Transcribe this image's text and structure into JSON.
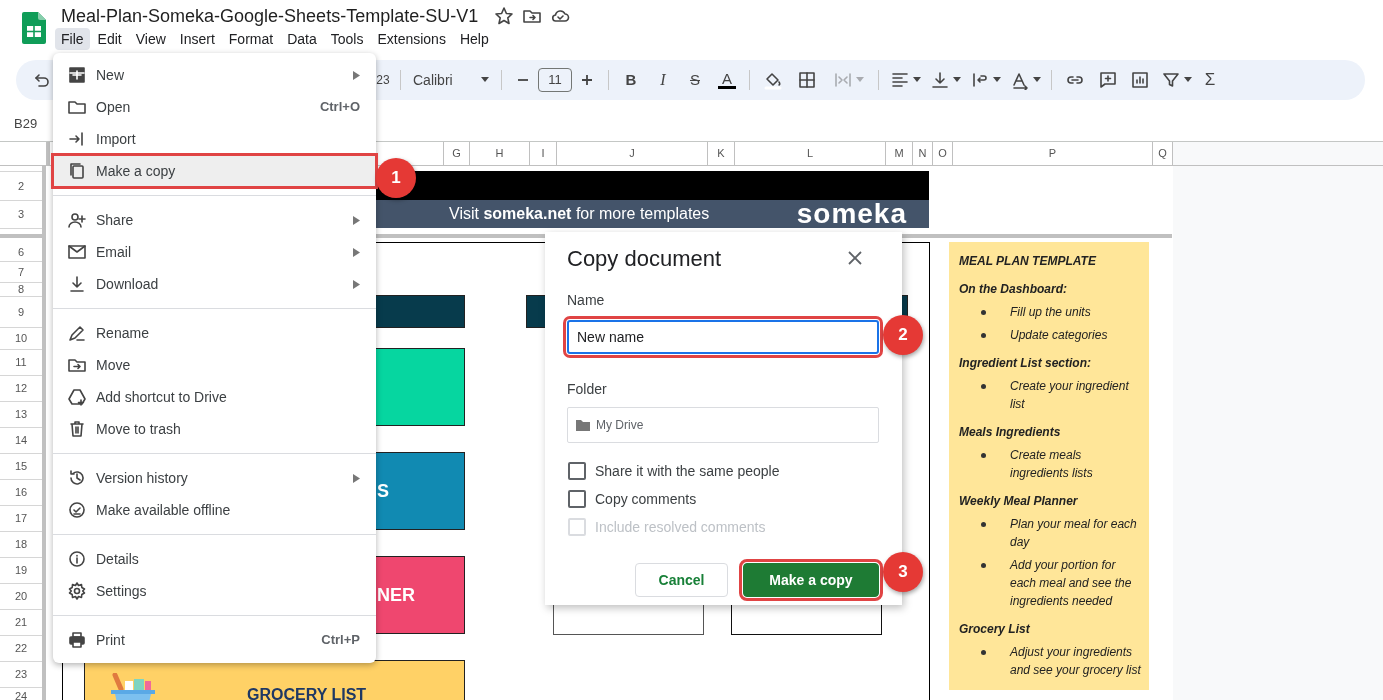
{
  "document": {
    "title": "Meal-Plan-Someka-Google-Sheets-Template-SU-V1"
  },
  "menubar": [
    {
      "label": "File",
      "selected": true
    },
    {
      "label": "Edit",
      "selected": false
    },
    {
      "label": "View",
      "selected": false
    },
    {
      "label": "Insert",
      "selected": false
    },
    {
      "label": "Format",
      "selected": false
    },
    {
      "label": "Data",
      "selected": false
    },
    {
      "label": "Tools",
      "selected": false
    },
    {
      "label": "Extensions",
      "selected": false
    },
    {
      "label": "Help",
      "selected": false
    }
  ],
  "toolbar": {
    "number_format": "23",
    "font": "Calibri",
    "font_size": "11",
    "bold": "B",
    "italic": "I",
    "strikethrough": "S",
    "text_color": "A",
    "functions": "Σ",
    "merge_disabled": true
  },
  "name_box": "B29",
  "columns": [
    "G",
    "H",
    "I",
    "J",
    "K",
    "L",
    "M",
    "N",
    "O",
    "P",
    "Q"
  ],
  "rows": [
    "2",
    "3",
    "6",
    "7",
    "8",
    "9",
    "10",
    "11",
    "12",
    "13",
    "14",
    "15",
    "16",
    "17",
    "18",
    "19",
    "20",
    "21",
    "22",
    "23",
    "24"
  ],
  "sheet": {
    "banner": {
      "text": "Visit **someka.net** for more templates",
      "logo": "someka"
    },
    "tiles": [
      {
        "color": "#073b4c"
      },
      {
        "color": "#073b4c"
      },
      {
        "color": "#06d6a0"
      },
      {
        "color": "#118ab2",
        "text": "S"
      },
      {
        "color": "#ef476f",
        "text": "NER"
      },
      {
        "color": "#ffd166",
        "text": "GROCERY LIST"
      }
    ],
    "note": {
      "title": "MEAL PLAN TEMPLATE",
      "sections": [
        {
          "heading": "On the Dashboard:",
          "bullets": [
            "Fill up the units",
            "Update categories"
          ]
        },
        {
          "heading": "Ingredient List section:",
          "bullets": [
            "Create your ingredient list"
          ]
        },
        {
          "heading": "Meals Ingredients",
          "bullets": [
            "Create meals ingredients lists"
          ]
        },
        {
          "heading": "Weekly Meal Planner",
          "bullets": [
            "Plan your meal for each day",
            "Add your portion for each meal and see the ingredients needed"
          ]
        },
        {
          "heading": "Grocery List",
          "bullets": [
            "Adjust your ingredients and see your grocery list"
          ]
        }
      ]
    }
  },
  "file_menu": [
    [
      {
        "label": "New",
        "submenu": true,
        "selected": false
      },
      {
        "label": "Open",
        "shortcut": "Ctrl+O",
        "submenu": false,
        "selected": false
      },
      {
        "label": "Import",
        "submenu": false,
        "selected": false
      },
      {
        "label": "Make a copy",
        "submenu": false,
        "selected": true
      }
    ],
    [
      {
        "label": "Share",
        "submenu": true,
        "selected": false
      },
      {
        "label": "Email",
        "submenu": true,
        "selected": false
      },
      {
        "label": "Download",
        "submenu": true,
        "selected": false
      }
    ],
    [
      {
        "label": "Rename",
        "submenu": false,
        "selected": false
      },
      {
        "label": "Move",
        "submenu": false,
        "selected": false
      },
      {
        "label": "Add shortcut to Drive",
        "submenu": false,
        "selected": false
      },
      {
        "label": "Move to trash",
        "submenu": false,
        "selected": false
      }
    ],
    [
      {
        "label": "Version history",
        "submenu": true,
        "selected": false
      },
      {
        "label": "Make available offline",
        "submenu": false,
        "selected": false
      }
    ],
    [
      {
        "label": "Details",
        "submenu": false,
        "selected": false
      },
      {
        "label": "Settings",
        "submenu": false,
        "selected": false
      }
    ],
    [
      {
        "label": "Print",
        "shortcut": "Ctrl+P",
        "submenu": false,
        "selected": false
      }
    ]
  ],
  "dialog": {
    "title": "Copy document",
    "name_label": "Name",
    "name_value": "New name",
    "folder_label": "Folder",
    "folder_value": "My Drive",
    "options": [
      {
        "label": "Share it with the same people",
        "checked": false,
        "disabled": false
      },
      {
        "label": "Copy comments",
        "checked": false,
        "disabled": false
      },
      {
        "label": "Include resolved comments",
        "checked": false,
        "disabled": true
      }
    ],
    "buttons": [
      {
        "label": "Cancel",
        "kind": "secondary"
      },
      {
        "label": "Make a copy",
        "kind": "primary"
      }
    ]
  },
  "callouts": [
    "1",
    "2",
    "3"
  ]
}
